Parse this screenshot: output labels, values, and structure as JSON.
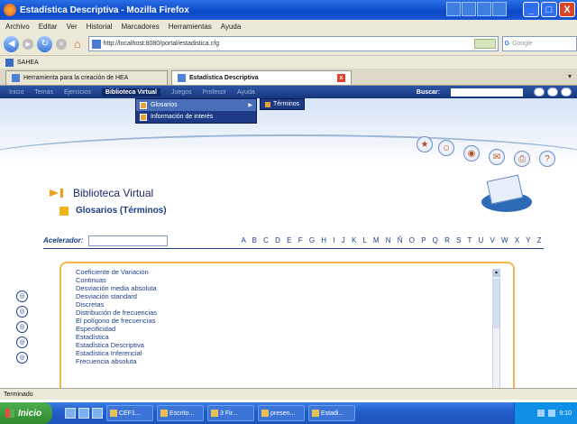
{
  "window": {
    "title": "Estadística Descriptiva - Mozilla Firefox",
    "minimize": "_",
    "maximize": "□",
    "close": "X"
  },
  "menubar": [
    "Archivo",
    "Editar",
    "Ver",
    "Historial",
    "Marcadores",
    "Herramientas",
    "Ayuda"
  ],
  "navbar": {
    "back_icon": "back-arrow-icon",
    "forward_icon": "forward-arrow-icon",
    "url": "http://localhost:8080/portal/estadistica.cfg",
    "search_placeholder": "Google",
    "search_logo": "G"
  },
  "bookmarks": {
    "item": "SAHEA"
  },
  "tabs": [
    {
      "label": "Herramienta para la creación de HEA"
    },
    {
      "label": "Estadística Descriptiva"
    }
  ],
  "site": {
    "nav_items": [
      "Inicio",
      "Temas",
      "Ejercicios",
      "Biblioteca Virtual",
      "Juegos",
      "Profesor",
      "Ayuda"
    ],
    "buscar_label": "Buscar:",
    "dropdown": [
      {
        "label": "Glosarios",
        "has_submenu": true
      },
      {
        "label": "Información de interés",
        "has_submenu": false
      }
    ],
    "submenu_item": "Términos",
    "circle_icons": [
      "star-icon",
      "people-icon",
      "rss-icon",
      "mail-icon",
      "print-icon",
      "help-icon"
    ]
  },
  "content": {
    "section_title": "Biblioteca Virtual",
    "subsection_title": "Glosarios (Términos)",
    "accelerator_label": "Acelerador:",
    "alphabet": "A B C D E F G H I J K L M N Ñ O P Q R S T U V W X Y Z",
    "terms": [
      "Coeficiente de Variación",
      "Continuas",
      "Desviación media absoluta",
      "Desviación standard",
      "Discretas",
      "Distribución de frecuencias",
      "El polígono de frecuencias",
      "Especificidad",
      "Estadística",
      "Estadística Descriptiva",
      "Estadística Inferencial",
      "Frecuencia absoluta"
    ]
  },
  "statusbar": {
    "text": "Terminado"
  },
  "taskbar": {
    "start": "Inicio",
    "tasks": [
      "",
      "CEF1...",
      "Escrito...",
      "3 Fir...",
      "presen...",
      "Estadi..."
    ],
    "clock": "9:10"
  }
}
